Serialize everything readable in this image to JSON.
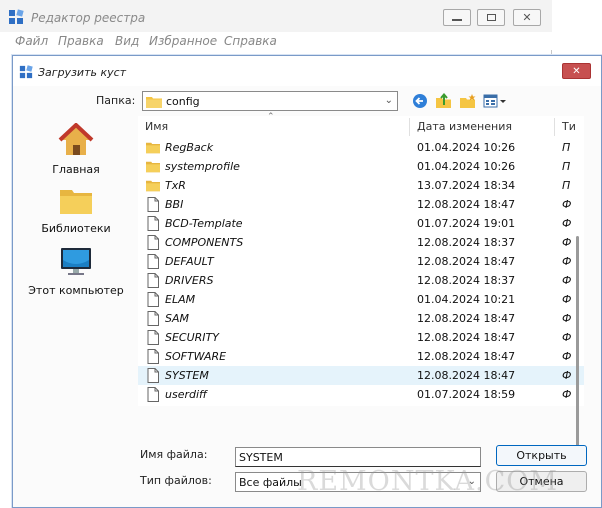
{
  "background_window": {
    "title": "Редактор реестра",
    "menu": [
      "Файл",
      "Правка",
      "Вид",
      "Избранное",
      "Справка"
    ]
  },
  "dialog": {
    "title": "Загрузить куст",
    "look_in_label": "Папка:",
    "look_in_value": "config",
    "toolbar_icons": [
      "back-icon",
      "up-folder-icon",
      "new-folder-icon",
      "view-menu-icon"
    ],
    "places": [
      {
        "label": "Главная",
        "icon": "home-icon"
      },
      {
        "label": "Библиотеки",
        "icon": "libraries-icon"
      },
      {
        "label": "Этот компьютер",
        "icon": "computer-icon"
      }
    ],
    "columns": {
      "name": "Имя",
      "date": "Дата изменения",
      "type": "Ти"
    },
    "files": [
      {
        "name": "RegBack",
        "date": "01.04.2024 10:26",
        "type": "П",
        "kind": "folder"
      },
      {
        "name": "systemprofile",
        "date": "01.04.2024 10:26",
        "type": "П",
        "kind": "folder"
      },
      {
        "name": "TxR",
        "date": "13.07.2024 18:34",
        "type": "П",
        "kind": "folder"
      },
      {
        "name": "BBI",
        "date": "12.08.2024 18:47",
        "type": "Ф",
        "kind": "file"
      },
      {
        "name": "BCD-Template",
        "date": "01.07.2024 19:01",
        "type": "Ф",
        "kind": "file"
      },
      {
        "name": "COMPONENTS",
        "date": "12.08.2024 18:37",
        "type": "Ф",
        "kind": "file"
      },
      {
        "name": "DEFAULT",
        "date": "12.08.2024 18:47",
        "type": "Ф",
        "kind": "file"
      },
      {
        "name": "DRIVERS",
        "date": "12.08.2024 18:37",
        "type": "Ф",
        "kind": "file"
      },
      {
        "name": "ELAM",
        "date": "01.04.2024 10:21",
        "type": "Ф",
        "kind": "file"
      },
      {
        "name": "SAM",
        "date": "12.08.2024 18:47",
        "type": "Ф",
        "kind": "file"
      },
      {
        "name": "SECURITY",
        "date": "12.08.2024 18:47",
        "type": "Ф",
        "kind": "file"
      },
      {
        "name": "SOFTWARE",
        "date": "12.08.2024 18:47",
        "type": "Ф",
        "kind": "file"
      },
      {
        "name": "SYSTEM",
        "date": "12.08.2024 18:47",
        "type": "Ф",
        "kind": "file",
        "selected": true
      },
      {
        "name": "userdiff",
        "date": "01.07.2024 18:59",
        "type": "Ф",
        "kind": "file"
      }
    ],
    "file_name_label": "Имя файла:",
    "file_name_value": "SYSTEM",
    "file_type_label": "Тип файлов:",
    "file_type_value": "Все файлы",
    "open_button": "Открыть",
    "cancel_button": "Отмена"
  },
  "watermark": "REMONTKA.COM",
  "colors": {
    "selection": "#e5f3fb",
    "close_button": "#c75050",
    "folder": "#f5c542",
    "accent": "#0067c0"
  }
}
